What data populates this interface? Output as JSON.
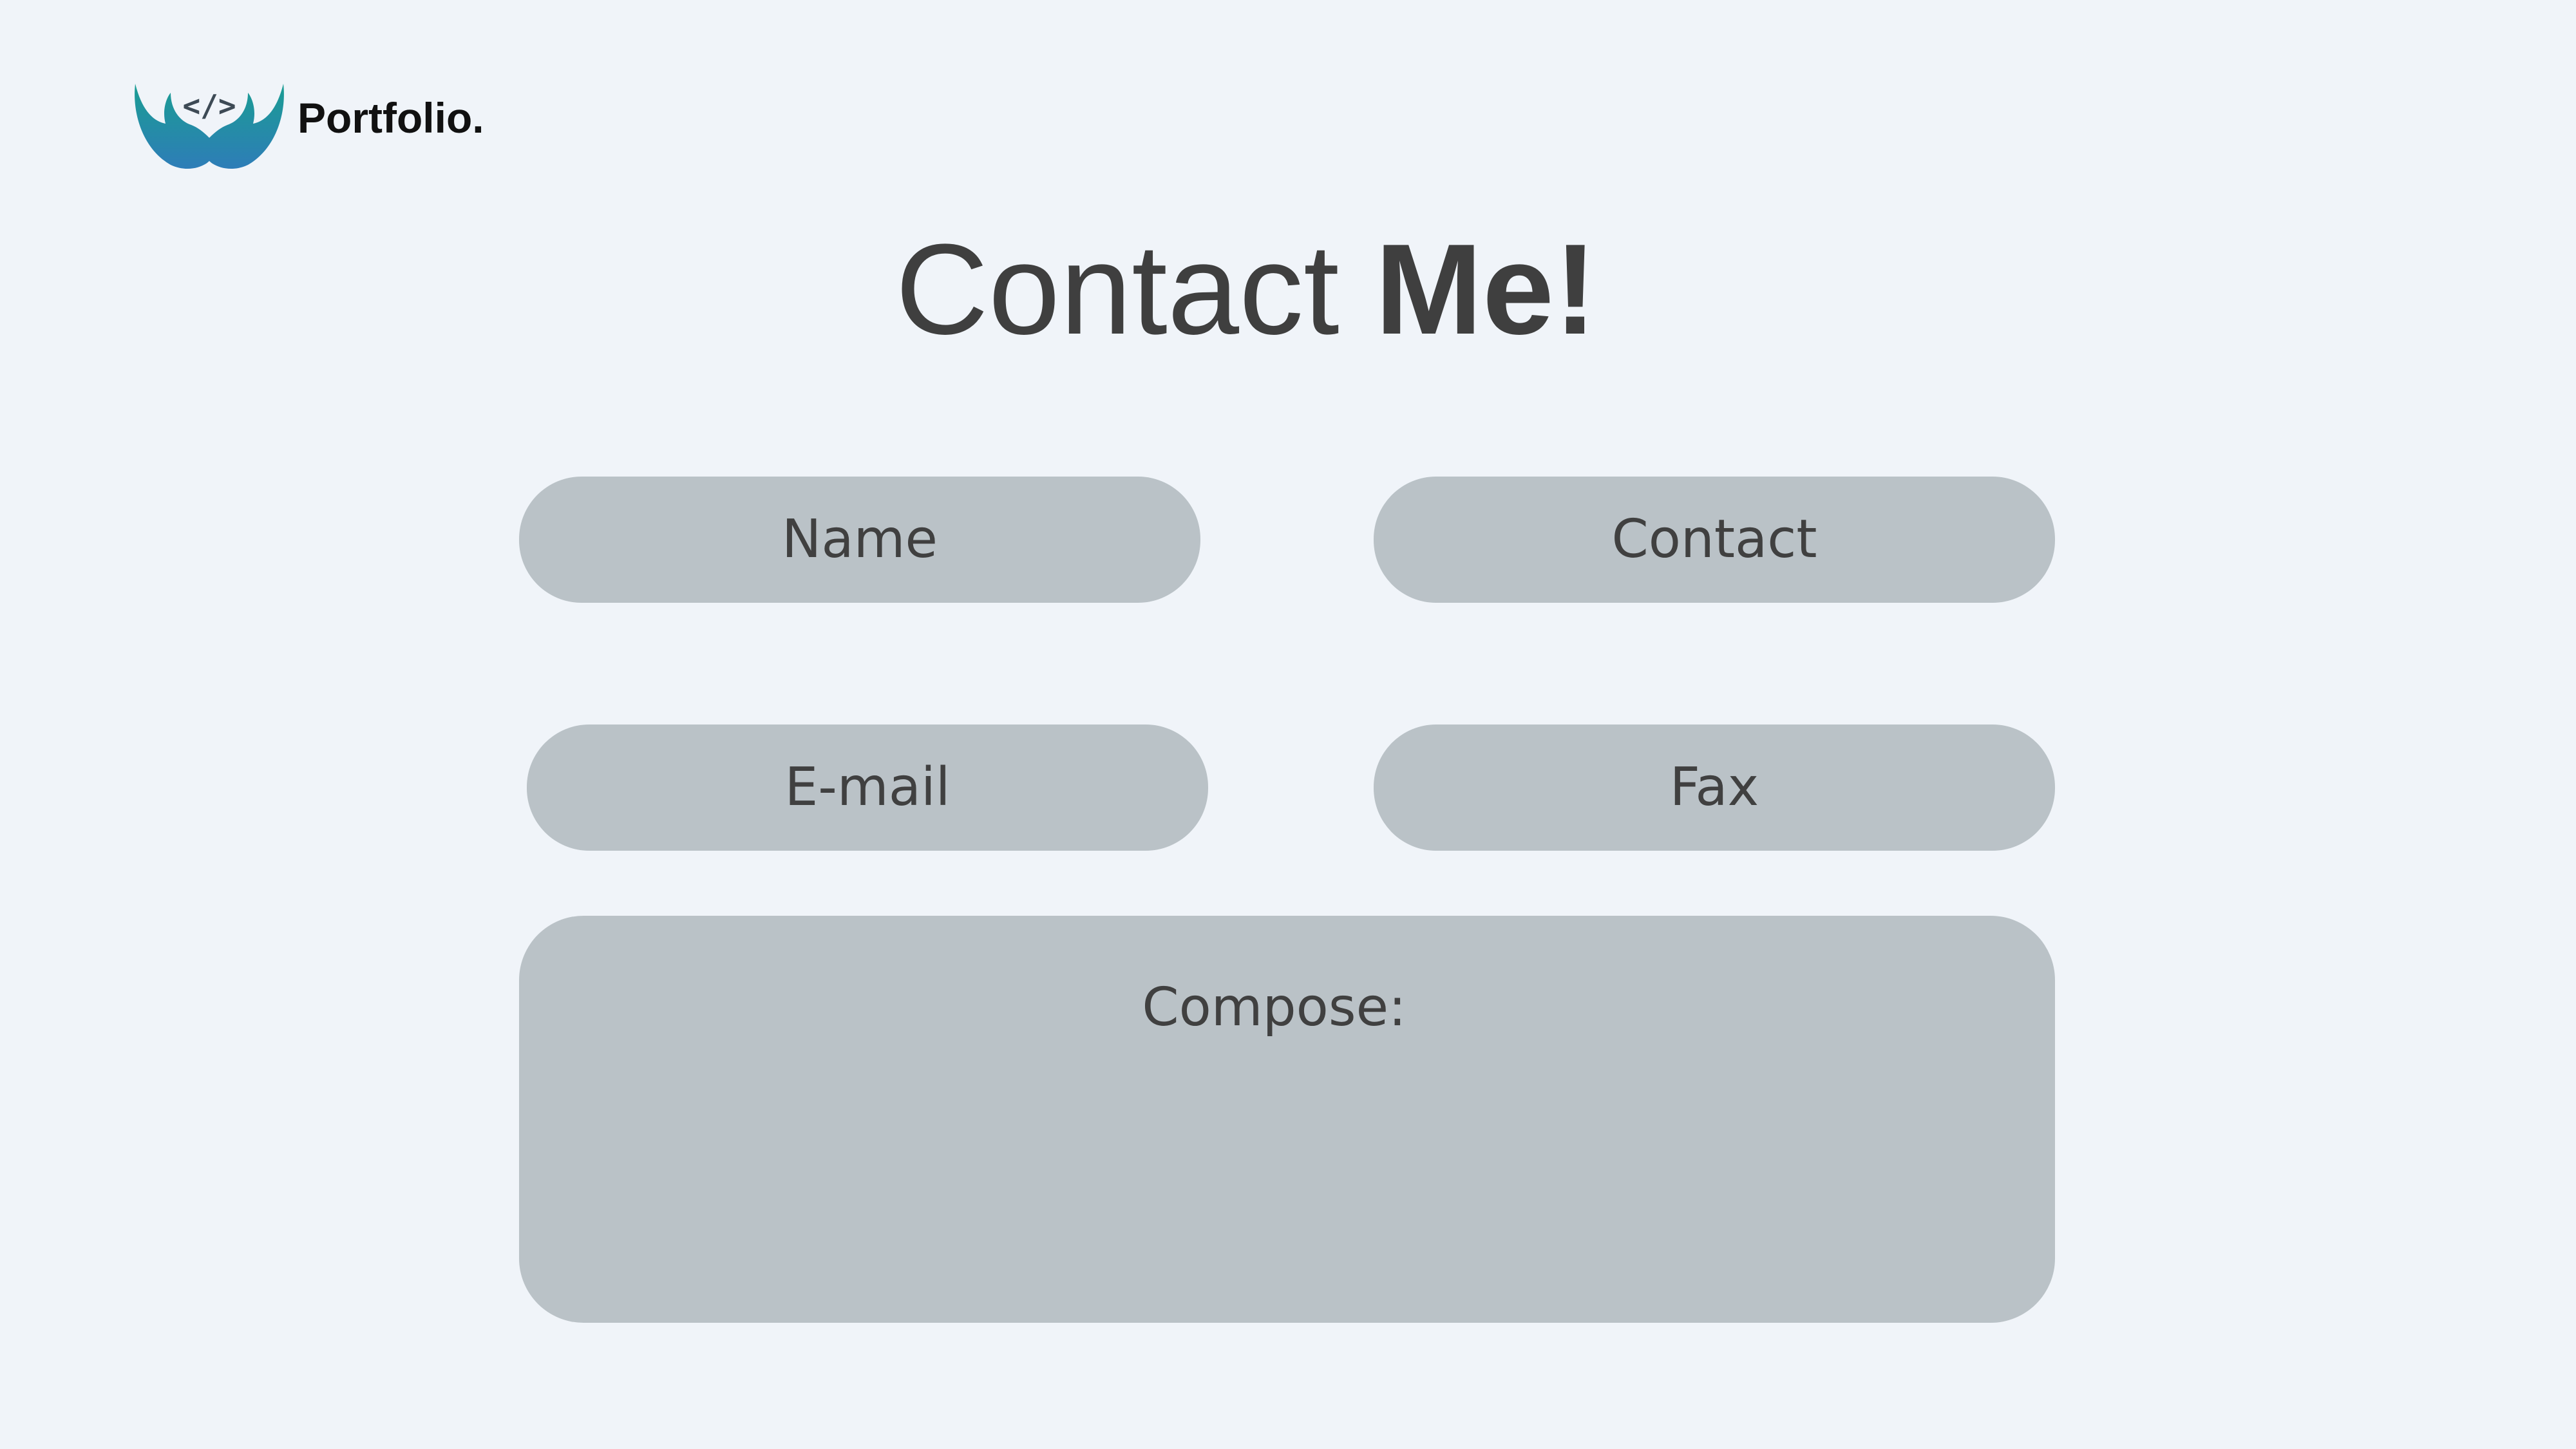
{
  "brand": {
    "name": "Portfolio.",
    "logo_icon": "code-brackets-icon",
    "logo_text": "</>",
    "logo_gradient": [
      "#1a9d93",
      "#2e7db8"
    ]
  },
  "heading": {
    "light": "Contact",
    "bold": "Me!"
  },
  "form": {
    "name_placeholder": "Name",
    "contact_placeholder": "Contact",
    "email_placeholder": "E-mail",
    "fax_placeholder": "Fax",
    "compose_placeholder": "Compose:"
  },
  "colors": {
    "background": "#f0f4f9",
    "field_fill": "#bac2c7",
    "text": "#404040"
  }
}
